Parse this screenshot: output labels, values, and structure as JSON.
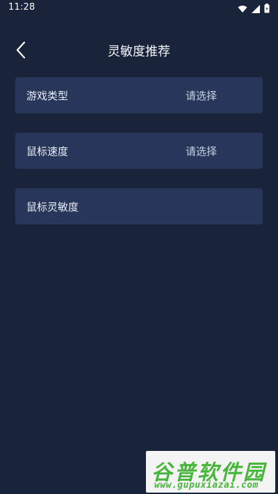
{
  "status_bar": {
    "time": "11:28",
    "icons": [
      "wifi-icon",
      "signal-icon",
      "battery-icon"
    ]
  },
  "header": {
    "title": "灵敏度推荐",
    "back_icon": "chevron-left-icon"
  },
  "form": {
    "items": [
      {
        "label": "游戏类型",
        "value": "请选择"
      },
      {
        "label": "鼠标速度",
        "value": "请选择"
      },
      {
        "label": "鼠标灵敏度",
        "value": ""
      }
    ]
  },
  "watermark": {
    "logo_text": "谷普软件园",
    "url": "www.gupuxiazai.com"
  },
  "colors": {
    "background": "#19233a",
    "card": "#27365a",
    "text": "#e8edf5",
    "watermark_green": "#48b53c"
  }
}
